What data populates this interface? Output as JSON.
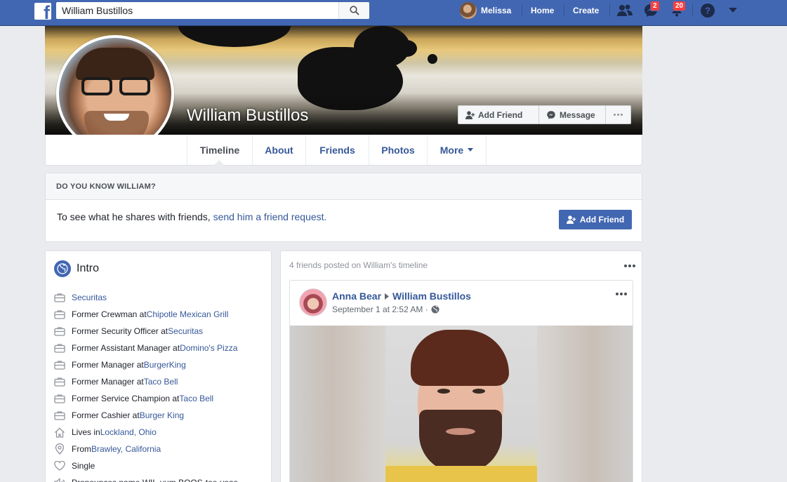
{
  "topbar": {
    "search_value": "William Bustillos",
    "user_name": "Melissa",
    "home_label": "Home",
    "create_label": "Create",
    "messages_count": "2",
    "notifications_count": "20"
  },
  "profile": {
    "name": "William Bustillos",
    "add_friend_label": "Add Friend",
    "message_label": "Message"
  },
  "tabs": [
    "Timeline",
    "About",
    "Friends",
    "Photos",
    "More"
  ],
  "know": {
    "heading": "DO YOU KNOW WILLIAM?",
    "text": "To see what he shares with friends, ",
    "link": "send him a friend request.",
    "button_label": "Add Friend"
  },
  "intro": {
    "title": "Intro",
    "items": [
      {
        "icon": "briefcase-icon",
        "prefix": "",
        "link": "Securitas"
      },
      {
        "icon": "briefcase-icon",
        "prefix": "Former Crewman at ",
        "link": "Chipotle Mexican Grill"
      },
      {
        "icon": "briefcase-icon",
        "prefix": "Former Security Officer at ",
        "link": "Securitas"
      },
      {
        "icon": "briefcase-icon",
        "prefix": "Former Assistant Manager at ",
        "link": "Domino's Pizza"
      },
      {
        "icon": "briefcase-icon",
        "prefix": "Former Manager at ",
        "link": "BurgerKing"
      },
      {
        "icon": "briefcase-icon",
        "prefix": "Former Manager at ",
        "link": "Taco Bell"
      },
      {
        "icon": "briefcase-icon",
        "prefix": "Former Service Champion at ",
        "link": "Taco Bell"
      },
      {
        "icon": "briefcase-icon",
        "prefix": "Former Cashier at ",
        "link": "Burger King"
      },
      {
        "icon": "home-icon",
        "prefix": "Lives in ",
        "link": "Lockland, Ohio"
      },
      {
        "icon": "location-pin-icon",
        "prefix": "From ",
        "link": "Brawley, California"
      },
      {
        "icon": "heart-icon",
        "prefix": "Single",
        "link": ""
      },
      {
        "icon": "sound-icon",
        "prefix": "Pronounces name WIL-yum BOOS-tee-yoas",
        "link": ""
      }
    ]
  },
  "timeline": {
    "header": "4 friends posted on William's timeline",
    "post": {
      "author": "Anna Bear",
      "target": "William Bustillos",
      "time": "September 1 at 2:52 AM · "
    }
  },
  "colors": {
    "brand_blue": "#4267b2",
    "link_blue": "#365899",
    "badge_red": "#fa3e3e",
    "page_bg": "#e9ebee"
  }
}
